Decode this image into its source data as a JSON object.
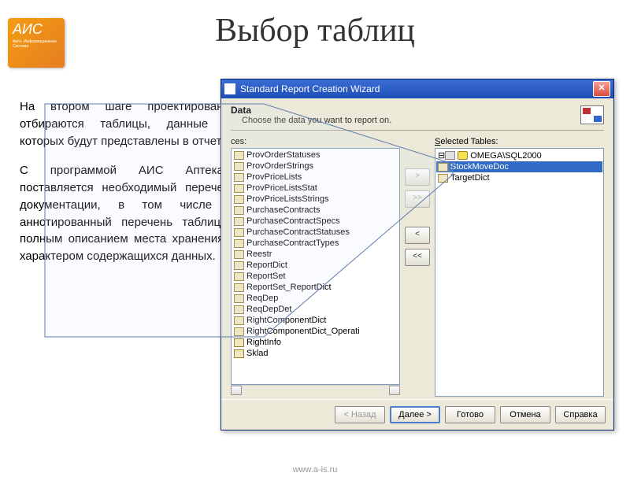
{
  "logo": {
    "brand": "АИС",
    "sub": "Авто-\nИнформационная\nСистема"
  },
  "page_title": "Выбор таблиц",
  "paragraph1": "На втором шаге проектирования отбираются таблицы, данные из которых будут представлены в отчете.",
  "paragraph2": "С программой АИС Аптекарь поставляется необходимый перечень документации, в том числе и аннотированный перечень таблиц с полным описанием места хранения и характером содержащихся данных.",
  "footer": "www.a-is.ru",
  "dialog": {
    "title": "Standard Report Creation Wizard",
    "step_title": "Data",
    "step_sub": "Choose the data you want to report on.",
    "left_label": "ces:",
    "right_label": "Selected Tables:",
    "tree_root": "OMEGA\\SQL2000",
    "selected": [
      "StockMoveDoc",
      "TargetDict"
    ],
    "available": [
      "ProvOrderStatuses",
      "ProvOrderStrings",
      "ProvPriceLists",
      "ProvPriceListsStat",
      "ProvPriceListsStrings",
      "PurchaseContracts",
      "PurchaseContractSpecs",
      "PurchaseContractStatuses",
      "PurchaseContractTypes",
      "Reestr",
      "ReportDict",
      "ReportSet",
      "ReportSet_ReportDict",
      "ReqDep",
      "ReqDepDet",
      "RightComponentDict",
      "RightComponentDict_Operati",
      "RightInfo",
      "Sklad"
    ],
    "btn_add": ">",
    "btn_add_all": ">>",
    "btn_rem": "<",
    "btn_rem_all": "<<",
    "btn_back": "< Назад",
    "btn_next": "Далее >",
    "btn_finish": "Готово",
    "btn_cancel": "Отмена",
    "btn_help": "Справка"
  }
}
